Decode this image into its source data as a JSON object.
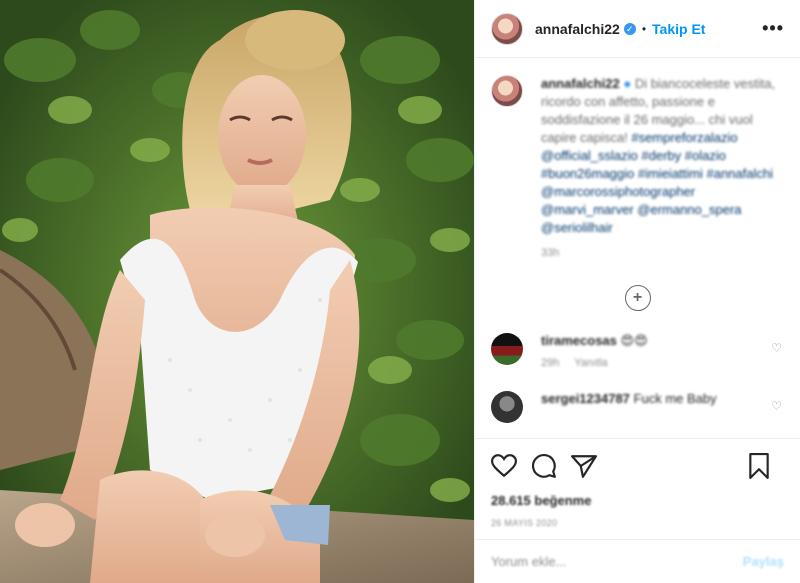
{
  "photo": {
    "alt": ""
  },
  "header": {
    "username": "annafalchi22",
    "verified_mark": "✓",
    "separator": "•",
    "follow_label": "Takip Et",
    "more_label": "•••"
  },
  "caption": {
    "username": "annafalchi22",
    "text": "Di biancoceleste vestita, ricordo con affetto, passione e soddisfazione il 26 maggio... chi vuol capire capisca!",
    "tags": "#sempreforzalazio @official_sslazio #derby #olazio #buon26maggio #imieiattimi #annafalchi @marcorossiphotographer @marvi_marver @ermanno_spera @seriolilhair",
    "time": "33h"
  },
  "load_more": "+",
  "comments": [
    {
      "username": "tiramecosas",
      "text": "😍😍",
      "time": "29h",
      "reply": "Yanıtla",
      "avatar_color": "#8a1b1b"
    },
    {
      "username": "sergei1234787",
      "text": "Fuck me Baby",
      "time": "",
      "reply": "",
      "avatar_color": "#444444"
    }
  ],
  "actions": {
    "likes": "28.615 beğenme",
    "date": "26 MAYIS 2020"
  },
  "add_comment": {
    "placeholder": "Yorum ekle...",
    "post_label": "Paylaş"
  },
  "colors": {
    "accent": "#0095f6",
    "verified": "#3897f0",
    "border": "#efefef"
  }
}
